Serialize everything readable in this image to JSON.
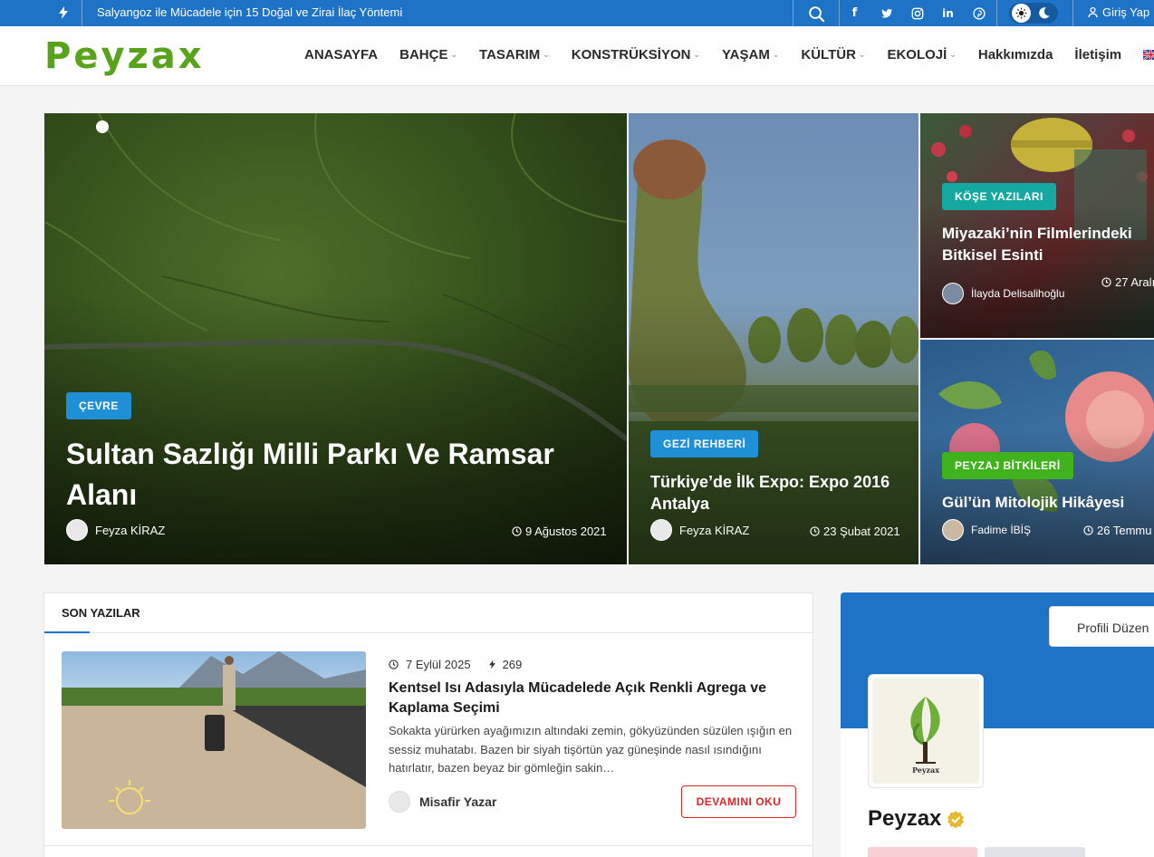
{
  "topbar": {
    "ticker": "Salyangoz ile Mücadele için 15 Doğal ve Zirai İlaç Yöntemi",
    "social": [
      "f",
      "t",
      "i",
      "in",
      "p"
    ],
    "login": "Giriş Yap"
  },
  "header": {
    "logo": "Peyzax",
    "nav": [
      {
        "label": "ANASAYFA",
        "caret": false
      },
      {
        "label": "BAHÇE",
        "caret": true
      },
      {
        "label": "TASARIM",
        "caret": true
      },
      {
        "label": "KONSTRÜKSİYON",
        "caret": true
      },
      {
        "label": "YAŞAM",
        "caret": true
      },
      {
        "label": "KÜLTÜR",
        "caret": true
      },
      {
        "label": "EKOLOJİ",
        "caret": true
      },
      {
        "label": "Hakkımızda",
        "caret": false
      },
      {
        "label": "İletişim",
        "caret": false
      },
      {
        "label": "En",
        "caret": false
      }
    ]
  },
  "hero": {
    "main": {
      "badge": "ÇEVRE",
      "title": "Sultan Sazlığı Milli Parkı Ve Ramsar Alanı",
      "author": "Feyza KİRAZ",
      "date": "9 Ağustos 2021"
    },
    "middle": {
      "badge": "GEZİ REHBERİ",
      "title": "Türkiye’de İlk Expo: Expo 2016 Antalya",
      "author": "Feyza KİRAZ",
      "date": "23 Şubat 2021"
    },
    "top_right": {
      "badge": "KÖŞE YAZILARI",
      "title": "Miyazaki’nin Filmlerindeki Bitkisel Esinti",
      "author": "İlayda Delisalihoğlu",
      "date": "27 Aralı"
    },
    "bottom_right": {
      "badge": "PEYZAJ BİTKİLERİ",
      "title": "Gül’ün Mitolojik Hikâyesi",
      "author": "Fadime İBİŞ",
      "date": "26 Temmu"
    }
  },
  "recent": {
    "tab": "SON YAZILAR",
    "post": {
      "date": "7 Eylül 2025",
      "views": "269",
      "title": "Kentsel Isı Adasıyla Mücadelede Açık Renkli Agrega ve Kaplama Seçimi",
      "excerpt": "Sokakta yürürken ayağımızın altındaki zemin, gökyüzünden süzülen ışığın en sessiz muhatabı. Bazen bir siyah tişörtün yaz güneşinde nasıl ısındığını hatırlatır, bazen beyaz bir gömleğin sakin…",
      "author": "Misafir Yazar",
      "readmore": "DEVAMINI OKU"
    }
  },
  "profile": {
    "edit_label": "Profili Düzen",
    "name": "Peyzax",
    "logo_text": "Peyzax"
  },
  "colors": {
    "brand_blue": "#1f73c7",
    "logo_green": "#57a41b",
    "badge_blue": "#1f8fd6",
    "badge_teal": "#14a8a0",
    "badge_green": "#3fb21d",
    "readmore_red": "#e02525"
  }
}
